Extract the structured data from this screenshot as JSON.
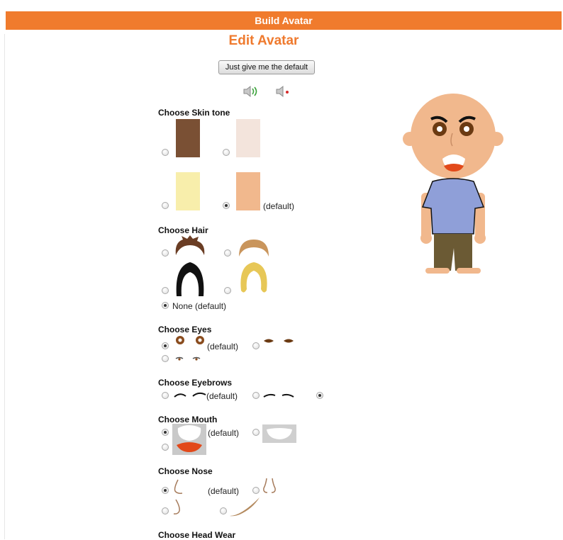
{
  "header": {
    "title": "Build Avatar"
  },
  "page": {
    "heading": "Edit Avatar",
    "default_button": "Just give me the default"
  },
  "audio": {
    "on_icon": "speaker-on-icon",
    "off_icon": "speaker-muted-icon"
  },
  "sections": {
    "skin_tone": {
      "title": "Choose Skin tone",
      "default_label": "(default)",
      "colors": [
        "#7a5034",
        "#f3e4dc",
        "#f8eeab",
        "#f1b88d"
      ],
      "selected_index": 3
    },
    "hair": {
      "title": "Choose Hair",
      "none_label": "None (default)",
      "selected": "none"
    },
    "eyes": {
      "title": "Choose Eyes",
      "default_label": "(default)",
      "selected_index": 0
    },
    "eyebrows": {
      "title": "Choose Eyebrows",
      "default_label": "(default)",
      "selected_index": 2
    },
    "mouth": {
      "title": "Choose Mouth",
      "default_label": "(default)",
      "selected_index": 0
    },
    "nose": {
      "title": "Choose Nose",
      "default_label": "(default)",
      "selected_index": 0
    },
    "head_wear": {
      "title": "Choose Head Wear"
    }
  },
  "avatar_colors": {
    "skin": "#f1b88d",
    "shirt": "#8f9fd8",
    "pants": "#6b5a34",
    "eyes": "#6b3a12"
  }
}
